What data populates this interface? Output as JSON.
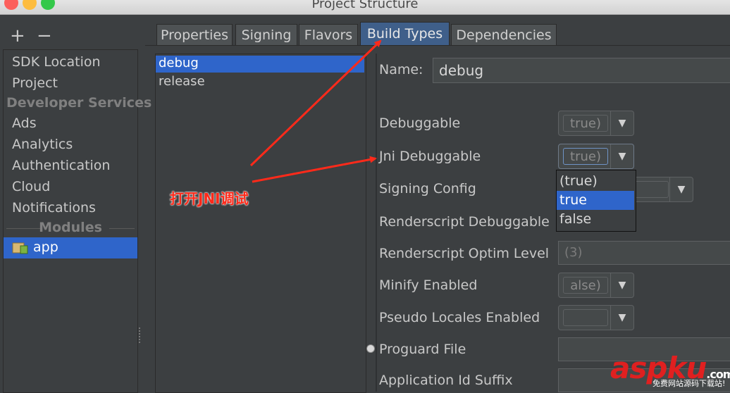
{
  "window": {
    "title": "Project Structure"
  },
  "toolbar": {
    "add_label": "+",
    "remove_label": "−"
  },
  "sidebar": {
    "items": [
      {
        "label": "SDK Location"
      },
      {
        "label": "Project"
      },
      {
        "label": "Developer Services"
      },
      {
        "label": "Ads"
      },
      {
        "label": "Analytics"
      },
      {
        "label": "Authentication"
      },
      {
        "label": "Cloud"
      },
      {
        "label": "Notifications"
      }
    ],
    "modules_header": "Modules",
    "modules": [
      {
        "label": "app",
        "icon": "android-module-icon"
      }
    ]
  },
  "tabs": [
    {
      "label": "Properties"
    },
    {
      "label": "Signing"
    },
    {
      "label": "Flavors"
    },
    {
      "label": "Build Types",
      "active": true
    },
    {
      "label": "Dependencies"
    }
  ],
  "build_types": [
    {
      "label": "debug",
      "selected": true
    },
    {
      "label": "release"
    }
  ],
  "form": {
    "name_label": "Name:",
    "name_value": "debug",
    "debuggable_label": "Debuggable",
    "debuggable_value": "true)",
    "jni_label": "Jni Debuggable",
    "jni_value": "true)",
    "signing_label": "Signing Config",
    "rs_debug_label": "Renderscript Debuggable",
    "rs_optim_label": "Renderscript Optim Level",
    "rs_optim_value": "(3)",
    "minify_label": "Minify Enabled",
    "minify_value": "alse)",
    "pseudo_label": "Pseudo Locales Enabled",
    "proguard_label": "Proguard File",
    "appid_label": "Application Id Suffix"
  },
  "dropdown": {
    "options": [
      "(true)",
      "true",
      "false"
    ],
    "selected_index": 1
  },
  "annotation": {
    "text": "打开JNI调试",
    "color": "#ff2a1a"
  },
  "watermark": {
    "brand": "aspku",
    "suffix": ".com",
    "caption": "免费网站源码下载站!"
  },
  "colors": {
    "selection": "#2f65ca",
    "background": "#3c3f41",
    "arrow": "#ff2a1a"
  }
}
